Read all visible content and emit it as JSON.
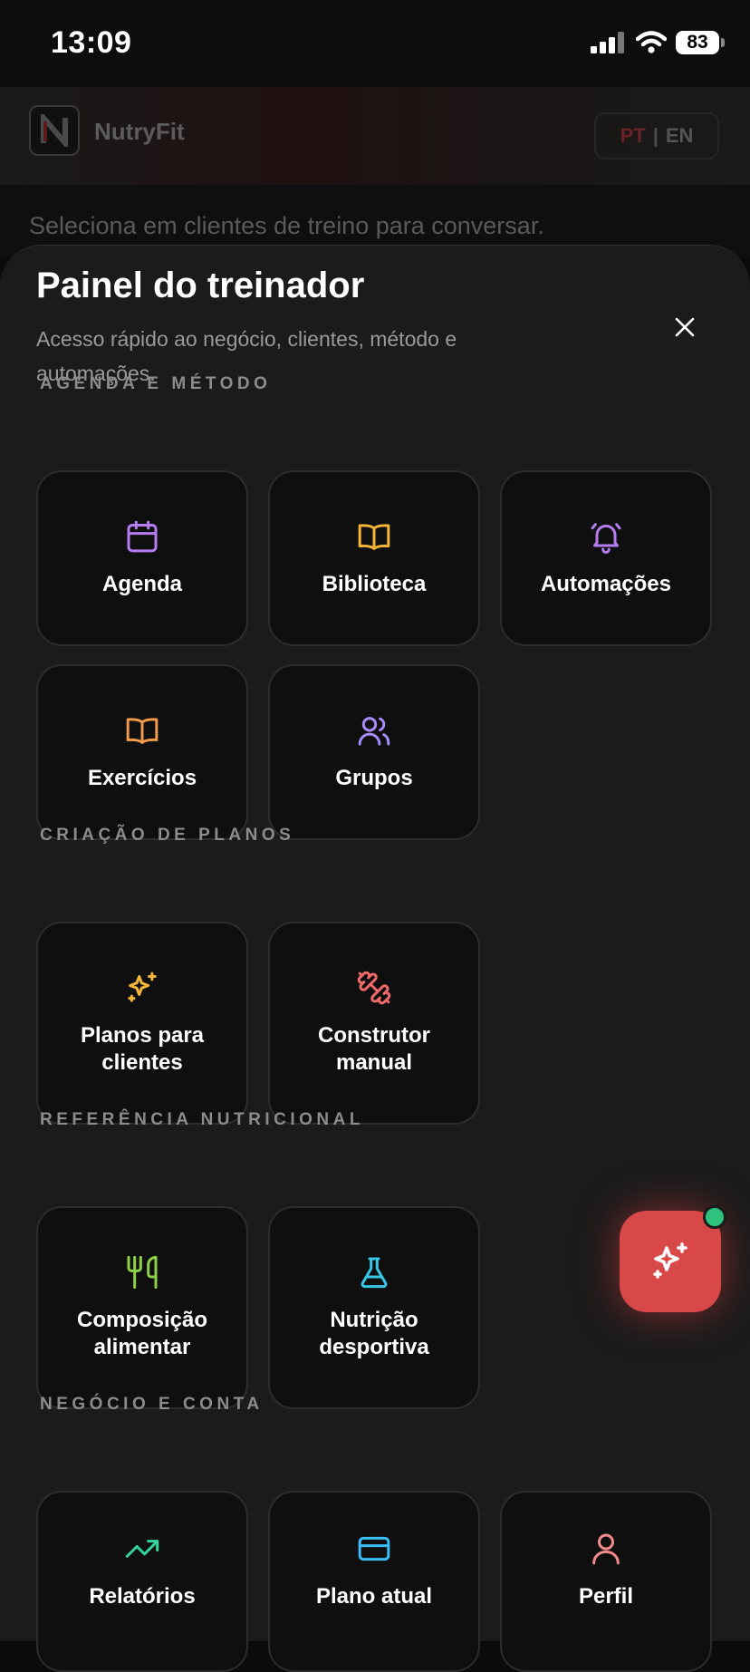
{
  "status_bar": {
    "time": "13:09",
    "battery": "83"
  },
  "app_header": {
    "logo_letter": "N",
    "app_name": "NutryFit",
    "lang_pt": "PT",
    "lang_sep": "|",
    "lang_en": "EN"
  },
  "background": {
    "hint": "Seleciona em clientes de treino para conversar."
  },
  "sheet": {
    "title": "Painel do treinador",
    "subtitle": "Acesso rápido ao negócio, clientes, método e automações."
  },
  "sections": {
    "agenda": {
      "title": "AGENDA E MÉTODO",
      "items": [
        {
          "label": "Agenda",
          "icon": "calendar-icon",
          "color": "#b57cf2"
        },
        {
          "label": "Biblioteca",
          "icon": "book-icon",
          "color": "#f5b638"
        },
        {
          "label": "Automações",
          "icon": "bell-icon",
          "color": "#b57cf2"
        },
        {
          "label": "Exercícios",
          "icon": "book-icon",
          "color": "#f29a4a"
        },
        {
          "label": "Grupos",
          "icon": "users-icon",
          "color": "#a78bfa"
        }
      ]
    },
    "plans": {
      "title": "CRIAÇÃO DE PLANOS",
      "items": [
        {
          "label": "Planos para clientes",
          "icon": "sparkles-icon",
          "color": "#f5b638"
        },
        {
          "label": "Construtor manual",
          "icon": "dumbbell-icon",
          "color": "#f06a6a"
        }
      ]
    },
    "nutrition": {
      "title": "REFERÊNCIA NUTRICIONAL",
      "items": [
        {
          "label": "Composição alimentar",
          "icon": "utensils-icon",
          "color": "#8ed147"
        },
        {
          "label": "Nutrição desportiva",
          "icon": "flask-icon",
          "color": "#38c6e8"
        }
      ]
    },
    "business": {
      "title": "NEGÓCIO E CONTA",
      "items": [
        {
          "label": "Relatórios",
          "icon": "trending-up-icon",
          "color": "#34d399"
        },
        {
          "label": "Plano atual",
          "icon": "credit-card-icon",
          "color": "#38bdf8"
        },
        {
          "label": "Perfil",
          "icon": "user-icon",
          "color": "#f48a8a"
        }
      ]
    }
  }
}
